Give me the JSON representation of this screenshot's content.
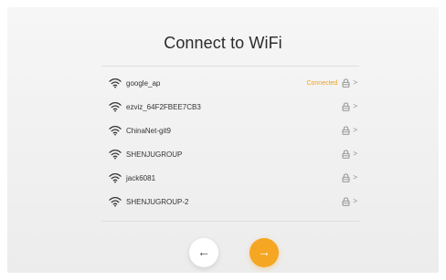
{
  "page": {
    "title": "Connect to WiFi"
  },
  "networks": [
    {
      "ssid": "google_ap",
      "status": "Connected",
      "locked": true
    },
    {
      "ssid": "ezviz_64F2FBEE7CB3",
      "status": "",
      "locked": true
    },
    {
      "ssid": "ChinaNet-git9",
      "status": "",
      "locked": true
    },
    {
      "ssid": "SHENJUGROUP",
      "status": "",
      "locked": true
    },
    {
      "ssid": "jack6081",
      "status": "",
      "locked": true
    },
    {
      "ssid": "SHENJUGROUP-2",
      "status": "",
      "locked": true
    }
  ],
  "icons": {
    "wifi": "wifi-icon",
    "lock": "lock-icon",
    "chevron": "chevron-right-icon",
    "back": "arrow-left-icon",
    "next": "arrow-right-icon"
  },
  "buttons": {
    "back_glyph": "←",
    "next_glyph": "→"
  },
  "row_chevron": ">",
  "colors": {
    "accent": "#f5a623",
    "connected_text": "#f2a21b",
    "background": "#f0f0f0"
  }
}
